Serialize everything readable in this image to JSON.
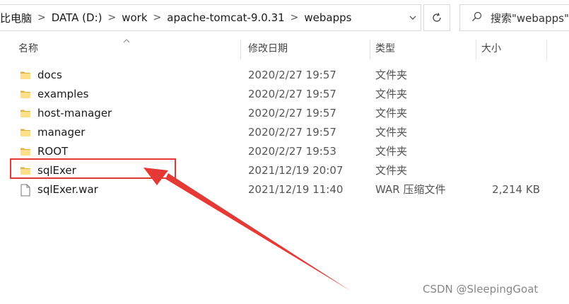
{
  "breadcrumb": {
    "items": [
      "比电脑",
      "DATA (D:)",
      "work",
      "apache-tomcat-9.0.31",
      "webapps"
    ],
    "separator": ">"
  },
  "refresh_icon": "refresh-icon",
  "search": {
    "placeholder": "搜索\"webapps\"",
    "icon": "search-icon"
  },
  "columns": {
    "name": "名称",
    "date": "修改日期",
    "type": "类型",
    "size": "大小"
  },
  "files": [
    {
      "name": "docs",
      "date": "2020/2/27 19:57",
      "type": "文件夹",
      "size": "",
      "icon": "folder-icon"
    },
    {
      "name": "examples",
      "date": "2020/2/27 19:57",
      "type": "文件夹",
      "size": "",
      "icon": "folder-icon"
    },
    {
      "name": "host-manager",
      "date": "2020/2/27 19:57",
      "type": "文件夹",
      "size": "",
      "icon": "folder-icon"
    },
    {
      "name": "manager",
      "date": "2020/2/27 19:57",
      "type": "文件夹",
      "size": "",
      "icon": "folder-icon"
    },
    {
      "name": "ROOT",
      "date": "2020/2/27 19:53",
      "type": "文件夹",
      "size": "",
      "icon": "folder-icon"
    },
    {
      "name": "sqlExer",
      "date": "2021/12/19 20:07",
      "type": "文件夹",
      "size": "",
      "icon": "folder-icon"
    },
    {
      "name": "sqlExer.war",
      "date": "2021/12/19 11:40",
      "type": "WAR 压缩文件",
      "size": "2,214 KB",
      "icon": "file-icon"
    }
  ],
  "annotation": {
    "color": "#e53935"
  },
  "watermark": "CSDN @SleepingGoat"
}
